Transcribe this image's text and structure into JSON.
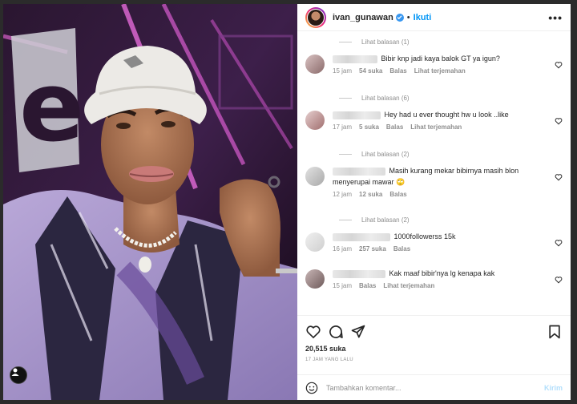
{
  "header": {
    "username": "ivan_gunawan",
    "separator": "•",
    "follow_label": "Ikuti",
    "more_label": "•••"
  },
  "comments": [
    {
      "type": "replies",
      "label": "Lihat balasan (1)"
    },
    {
      "type": "comment",
      "text": "Bibir knp jadi kaya balok GT ya igun?",
      "time": "15 jam",
      "likes": "54 suka",
      "reply": "Balas",
      "translate": "Lihat terjemahan",
      "avatar_color": "#b08a8a"
    },
    {
      "type": "replies",
      "label": "Lihat balasan (6)"
    },
    {
      "type": "comment",
      "text": "Hey had u ever thought hw u look ..like",
      "time": "17 jam",
      "likes": "5 suka",
      "reply": "Balas",
      "translate": "Lihat terjemahan",
      "avatar_color": "#c29393"
    },
    {
      "type": "replies",
      "label": "Lihat balasan (2)"
    },
    {
      "type": "comment",
      "text": "Masih kurang mekar bibirnya masih blon menyerupai mawar 🙄",
      "time": "12 jam",
      "likes": "12 suka",
      "reply": "Balas",
      "translate": "",
      "avatar_color": "#bdbdbd"
    },
    {
      "type": "replies",
      "label": "Lihat balasan (2)"
    },
    {
      "type": "comment",
      "text": "1000followerss 15k",
      "time": "16 jam",
      "likes": "257 suka",
      "reply": "Balas",
      "translate": "",
      "avatar_color": "#d9d9d9"
    },
    {
      "type": "comment",
      "text": "Kak maaf bibir'nya lg kenapa kak",
      "time": "15 jam",
      "likes": "",
      "reply": "Balas",
      "translate": "Lihat terjemahan",
      "avatar_color": "#9e8686"
    }
  ],
  "actions": {
    "likes": "20,515 suka",
    "time": "17 JAM YANG LALU"
  },
  "composer": {
    "placeholder": "Tambahkan komentar...",
    "post_label": "Kirim"
  },
  "colors": {
    "accent": "#0095f6",
    "verified": "#3897f0"
  }
}
